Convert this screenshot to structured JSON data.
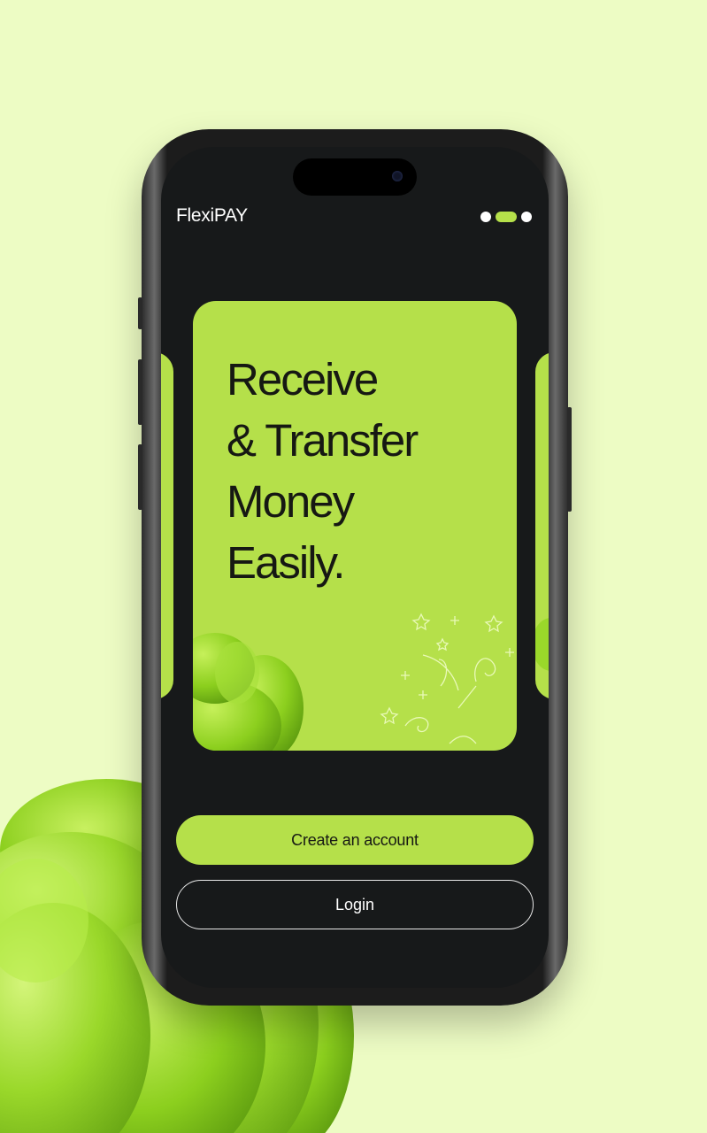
{
  "app": {
    "brand": "FlexiPAY"
  },
  "pager": {
    "total": 3,
    "active_index": 1
  },
  "hero_card": {
    "headline_lines": [
      "Receive",
      "& Transfer",
      "Money",
      "Easily."
    ]
  },
  "actions": {
    "create_account_label": "Create an account",
    "login_label": "Login"
  },
  "colors": {
    "background": "#edfcc4",
    "accent": "#b5e04a",
    "screen": "#17191a",
    "text_dark": "#161813",
    "text_light": "#ffffff"
  },
  "icons": {
    "decorative_blob": "green-3d-swirl",
    "doodles": "sparkle-doodles"
  }
}
